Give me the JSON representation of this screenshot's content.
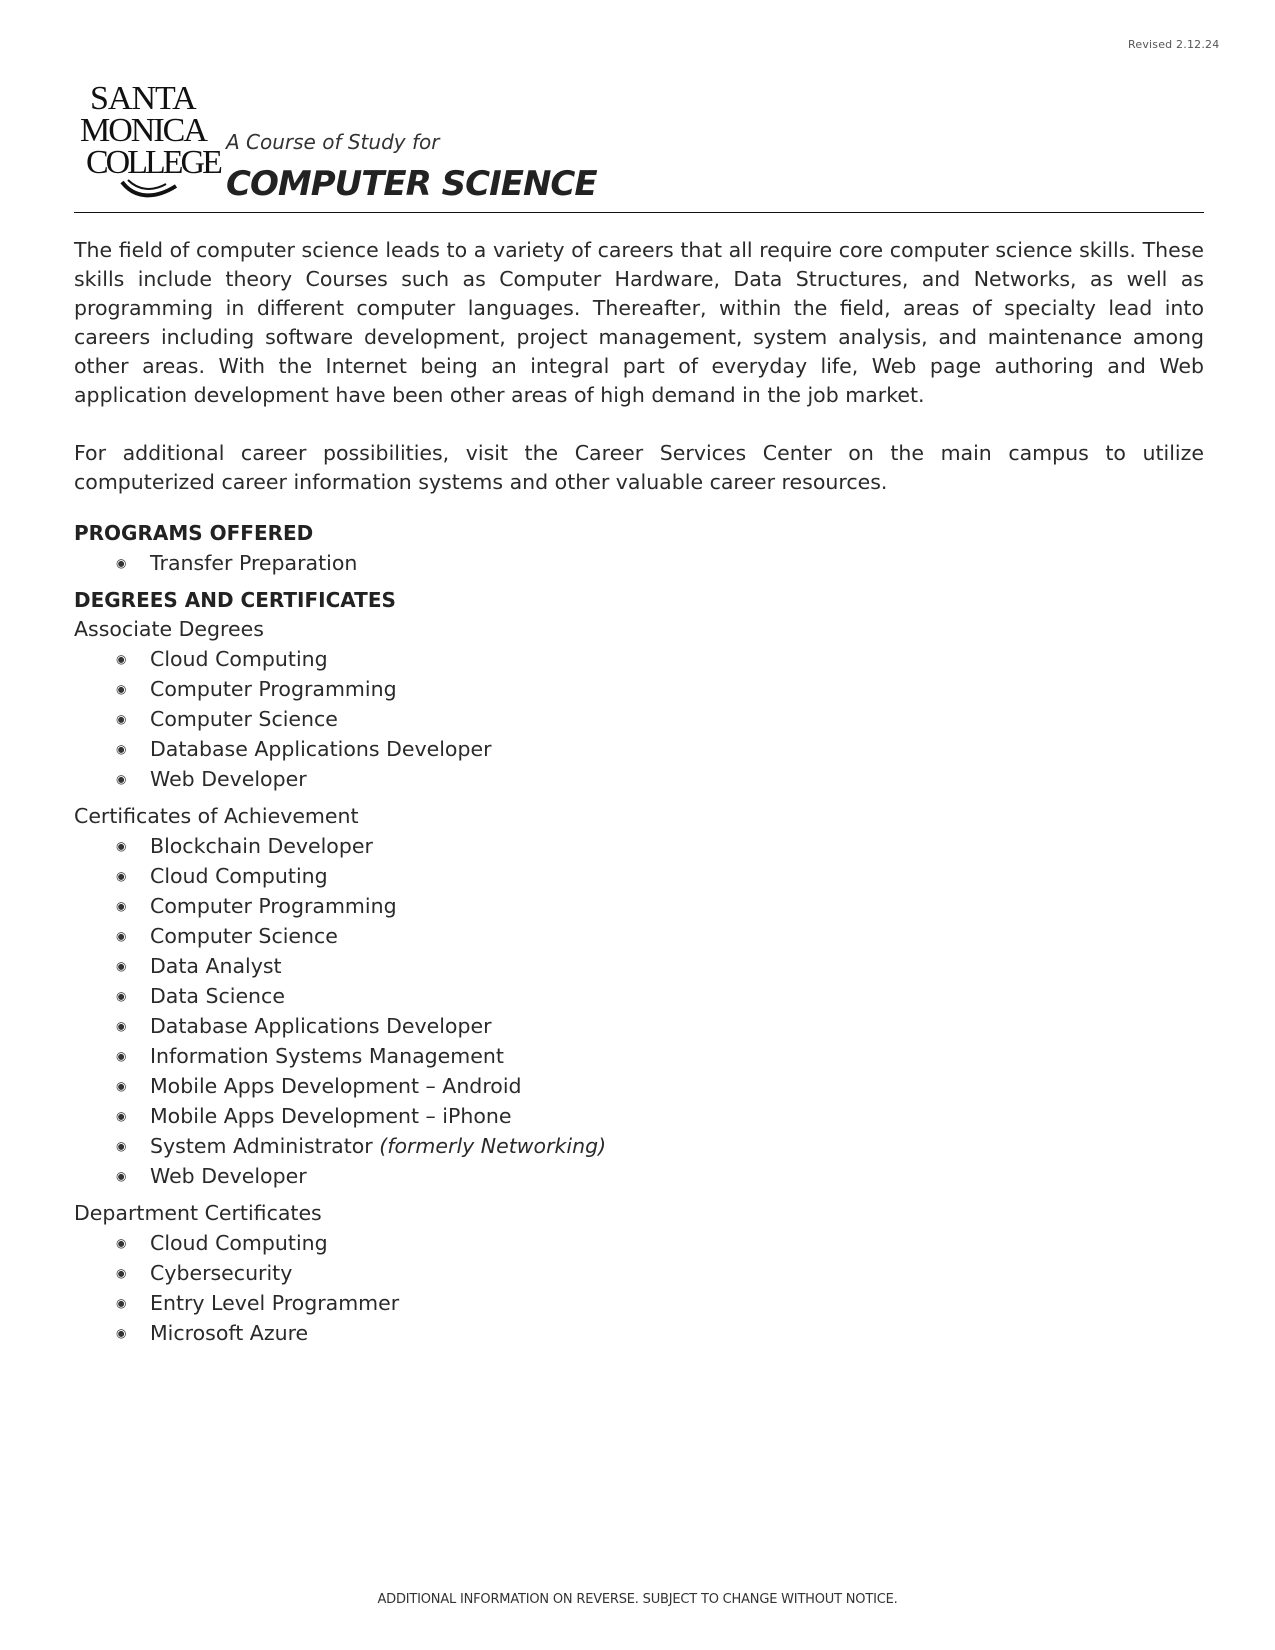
{
  "header": {
    "revised": "Revised 2.12.24",
    "logo_lines": [
      "SANTA",
      "MONICA",
      "COLLEGE"
    ],
    "subtitle": "A Course of Study for",
    "title": "COMPUTER SCIENCE"
  },
  "intro": {
    "paragraph1": "The field of computer science leads to a variety of careers that all require core computer science skills. These skills include theory Courses such as Computer Hardware, Data Structures, and Networks, as well as programming in different computer languages. Thereafter, within the field, areas of specialty lead into careers including software development, project management, system analysis, and maintenance among other areas. With the Internet being an integral part of everyday life, Web page authoring and Web application development have been other areas of high demand in the job market.",
    "paragraph2": "For additional career possibilities, visit the Career Services Center on the main campus to utilize computerized career information systems and other valuable career resources."
  },
  "programs": {
    "heading": "PROGRAMS OFFERED",
    "items": [
      "Transfer Preparation"
    ]
  },
  "degrees": {
    "heading": "DEGREES AND CERTIFICATES",
    "associate": {
      "label": "Associate Degrees",
      "items": [
        "Cloud Computing",
        "Computer Programming",
        "Computer Science",
        "Database Applications Developer",
        "Web Developer"
      ]
    },
    "achievement": {
      "label": "Certificates of Achievement",
      "items": [
        "Blockchain Developer",
        "Cloud Computing",
        "Computer Programming",
        "Computer Science",
        "Data Analyst",
        "Data Science",
        "Database Applications Developer",
        "Information Systems Management",
        "Mobile Apps Development – Android",
        "Mobile Apps Development – iPhone",
        "System Administrator",
        "Web Developer"
      ],
      "note_item_index": 10,
      "note": "(formerly Networking)"
    },
    "department": {
      "label": "Department Certificates",
      "items": [
        "Cloud Computing",
        "Cybersecurity",
        "Entry Level Programmer",
        "Microsoft Azure"
      ]
    }
  },
  "bullet_glyph": "◉",
  "footer": "ADDITIONAL INFORMATION ON REVERSE.  SUBJECT TO CHANGE WITHOUT NOTICE."
}
